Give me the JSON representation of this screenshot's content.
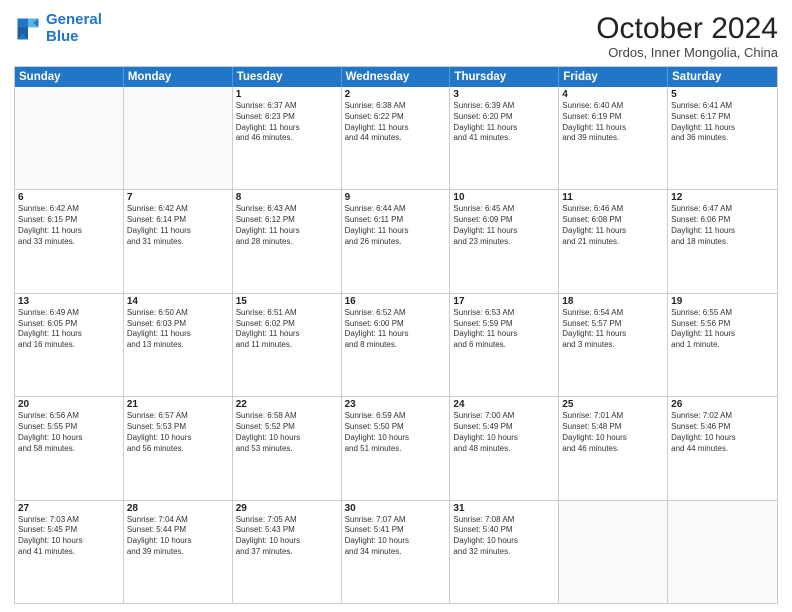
{
  "logo": {
    "line1": "General",
    "line2": "Blue"
  },
  "title": "October 2024",
  "location": "Ordos, Inner Mongolia, China",
  "days_of_week": [
    "Sunday",
    "Monday",
    "Tuesday",
    "Wednesday",
    "Thursday",
    "Friday",
    "Saturday"
  ],
  "weeks": [
    [
      {
        "day": "",
        "info": ""
      },
      {
        "day": "",
        "info": ""
      },
      {
        "day": "1",
        "info": "Sunrise: 6:37 AM\nSunset: 6:23 PM\nDaylight: 11 hours\nand 46 minutes."
      },
      {
        "day": "2",
        "info": "Sunrise: 6:38 AM\nSunset: 6:22 PM\nDaylight: 11 hours\nand 44 minutes."
      },
      {
        "day": "3",
        "info": "Sunrise: 6:39 AM\nSunset: 6:20 PM\nDaylight: 11 hours\nand 41 minutes."
      },
      {
        "day": "4",
        "info": "Sunrise: 6:40 AM\nSunset: 6:19 PM\nDaylight: 11 hours\nand 39 minutes."
      },
      {
        "day": "5",
        "info": "Sunrise: 6:41 AM\nSunset: 6:17 PM\nDaylight: 11 hours\nand 36 minutes."
      }
    ],
    [
      {
        "day": "6",
        "info": "Sunrise: 6:42 AM\nSunset: 6:15 PM\nDaylight: 11 hours\nand 33 minutes."
      },
      {
        "day": "7",
        "info": "Sunrise: 6:42 AM\nSunset: 6:14 PM\nDaylight: 11 hours\nand 31 minutes."
      },
      {
        "day": "8",
        "info": "Sunrise: 6:43 AM\nSunset: 6:12 PM\nDaylight: 11 hours\nand 28 minutes."
      },
      {
        "day": "9",
        "info": "Sunrise: 6:44 AM\nSunset: 6:11 PM\nDaylight: 11 hours\nand 26 minutes."
      },
      {
        "day": "10",
        "info": "Sunrise: 6:45 AM\nSunset: 6:09 PM\nDaylight: 11 hours\nand 23 minutes."
      },
      {
        "day": "11",
        "info": "Sunrise: 6:46 AM\nSunset: 6:08 PM\nDaylight: 11 hours\nand 21 minutes."
      },
      {
        "day": "12",
        "info": "Sunrise: 6:47 AM\nSunset: 6:06 PM\nDaylight: 11 hours\nand 18 minutes."
      }
    ],
    [
      {
        "day": "13",
        "info": "Sunrise: 6:49 AM\nSunset: 6:05 PM\nDaylight: 11 hours\nand 16 minutes."
      },
      {
        "day": "14",
        "info": "Sunrise: 6:50 AM\nSunset: 6:03 PM\nDaylight: 11 hours\nand 13 minutes."
      },
      {
        "day": "15",
        "info": "Sunrise: 6:51 AM\nSunset: 6:02 PM\nDaylight: 11 hours\nand 11 minutes."
      },
      {
        "day": "16",
        "info": "Sunrise: 6:52 AM\nSunset: 6:00 PM\nDaylight: 11 hours\nand 8 minutes."
      },
      {
        "day": "17",
        "info": "Sunrise: 6:53 AM\nSunset: 5:59 PM\nDaylight: 11 hours\nand 6 minutes."
      },
      {
        "day": "18",
        "info": "Sunrise: 6:54 AM\nSunset: 5:57 PM\nDaylight: 11 hours\nand 3 minutes."
      },
      {
        "day": "19",
        "info": "Sunrise: 6:55 AM\nSunset: 5:56 PM\nDaylight: 11 hours\nand 1 minute."
      }
    ],
    [
      {
        "day": "20",
        "info": "Sunrise: 6:56 AM\nSunset: 5:55 PM\nDaylight: 10 hours\nand 58 minutes."
      },
      {
        "day": "21",
        "info": "Sunrise: 6:57 AM\nSunset: 5:53 PM\nDaylight: 10 hours\nand 56 minutes."
      },
      {
        "day": "22",
        "info": "Sunrise: 6:58 AM\nSunset: 5:52 PM\nDaylight: 10 hours\nand 53 minutes."
      },
      {
        "day": "23",
        "info": "Sunrise: 6:59 AM\nSunset: 5:50 PM\nDaylight: 10 hours\nand 51 minutes."
      },
      {
        "day": "24",
        "info": "Sunrise: 7:00 AM\nSunset: 5:49 PM\nDaylight: 10 hours\nand 48 minutes."
      },
      {
        "day": "25",
        "info": "Sunrise: 7:01 AM\nSunset: 5:48 PM\nDaylight: 10 hours\nand 46 minutes."
      },
      {
        "day": "26",
        "info": "Sunrise: 7:02 AM\nSunset: 5:46 PM\nDaylight: 10 hours\nand 44 minutes."
      }
    ],
    [
      {
        "day": "27",
        "info": "Sunrise: 7:03 AM\nSunset: 5:45 PM\nDaylight: 10 hours\nand 41 minutes."
      },
      {
        "day": "28",
        "info": "Sunrise: 7:04 AM\nSunset: 5:44 PM\nDaylight: 10 hours\nand 39 minutes."
      },
      {
        "day": "29",
        "info": "Sunrise: 7:05 AM\nSunset: 5:43 PM\nDaylight: 10 hours\nand 37 minutes."
      },
      {
        "day": "30",
        "info": "Sunrise: 7:07 AM\nSunset: 5:41 PM\nDaylight: 10 hours\nand 34 minutes."
      },
      {
        "day": "31",
        "info": "Sunrise: 7:08 AM\nSunset: 5:40 PM\nDaylight: 10 hours\nand 32 minutes."
      },
      {
        "day": "",
        "info": ""
      },
      {
        "day": "",
        "info": ""
      }
    ]
  ]
}
